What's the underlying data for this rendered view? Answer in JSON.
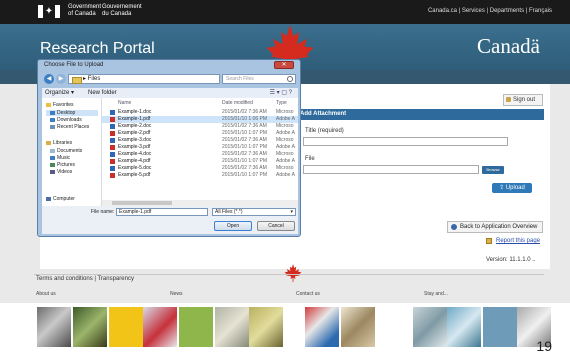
{
  "gov_bar": {
    "name_en_1": "Government",
    "name_en_2": "of Canada",
    "name_fr_1": "Gouvernement",
    "name_fr_2": "du Canada",
    "links": "Canada.ca  |  Services  |  Departments  |  Français"
  },
  "banner": {
    "title": "Research Portal",
    "wordmark": "Canadä"
  },
  "toolbar": {
    "sign_out": "Sign out"
  },
  "attachment": {
    "heading": "Add Attachment",
    "title_label": "Title (required)",
    "file_label": "File",
    "browse_label": "Browse",
    "upload_label": "Upload"
  },
  "actions": {
    "back_label": "Back to Application Overview",
    "report_label": "Report this page",
    "version": "Version:  11.1.1.0 .."
  },
  "footer": {
    "links": "Terms and conditions  |  Transparency",
    "sections": [
      "About us",
      "News",
      "Contact us",
      "Stay and..."
    ]
  },
  "page_number": "19",
  "dialog": {
    "title": "Choose File to Upload",
    "address_path": "▸ Files",
    "search_placeholder": "Search Files",
    "organize_label": "Organize ▾",
    "new_folder_label": "New folder",
    "nav_items": [
      {
        "label": "Favorites",
        "icon": "star-icon"
      },
      {
        "label": "Desktop",
        "icon": "desktop-icon"
      },
      {
        "label": "Downloads",
        "icon": "download-folder-icon"
      },
      {
        "label": "Recent Places",
        "icon": "recent-places-icon"
      },
      {
        "label": "Libraries",
        "icon": "library-icon"
      },
      {
        "label": "Documents",
        "icon": "documents-icon"
      },
      {
        "label": "Music",
        "icon": "music-icon"
      },
      {
        "label": "Pictures",
        "icon": "pictures-icon"
      },
      {
        "label": "Videos",
        "icon": "videos-icon"
      },
      {
        "label": "Computer",
        "icon": "computer-icon"
      }
    ],
    "columns": {
      "name": "Name",
      "date": "Date modified",
      "type": "Type"
    },
    "files": [
      {
        "name": "Example-1.doc",
        "date": "2015/01/02 7:36 AM",
        "type": "Microso",
        "kind": "doc"
      },
      {
        "name": "Example-1.pdf",
        "date": "2015/01/10 1:06 PM",
        "type": "Adobe A",
        "kind": "pdf"
      },
      {
        "name": "Example-2.doc",
        "date": "2015/01/02 7:36 AM",
        "type": "Microso",
        "kind": "doc"
      },
      {
        "name": "Example-2.pdf",
        "date": "2015/01/10 1:07 PM",
        "type": "Adobe A",
        "kind": "pdf"
      },
      {
        "name": "Example-3.doc",
        "date": "2015/01/02 7:36 AM",
        "type": "Microso",
        "kind": "doc"
      },
      {
        "name": "Example-3.pdf",
        "date": "2015/01/10 1:07 PM",
        "type": "Adobe A",
        "kind": "pdf"
      },
      {
        "name": "Example-4.doc",
        "date": "2015/01/02 7:36 AM",
        "type": "Microso",
        "kind": "doc"
      },
      {
        "name": "Example-4.pdf",
        "date": "2015/01/10 1:07 PM",
        "type": "Adobe A",
        "kind": "pdf"
      },
      {
        "name": "Example-5.doc",
        "date": "2015/01/02 7:36 AM",
        "type": "Microso",
        "kind": "doc"
      },
      {
        "name": "Example-5.pdf",
        "date": "2015/01/10 1:07 PM",
        "type": "Adobe A",
        "kind": "pdf"
      }
    ],
    "selected_file_index": 1,
    "filename_label": "File name:",
    "filename_value": "Example-1.pdf",
    "filter_value": "All Files (*.*)",
    "open_label": "Open",
    "cancel_label": "Cancel"
  },
  "colors": {
    "banner_blue": "#2e5d79",
    "accent_blue": "#2e6a9b",
    "canada_red": "#d52b1e"
  }
}
